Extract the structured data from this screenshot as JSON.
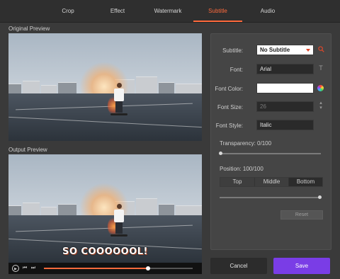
{
  "tabs": [
    {
      "label": "Crop"
    },
    {
      "label": "Effect"
    },
    {
      "label": "Watermark"
    },
    {
      "label": "Subtitle",
      "active": true
    },
    {
      "label": "Audio"
    }
  ],
  "original_preview": {
    "label": "Original Preview"
  },
  "output_preview": {
    "label": "Output Preview",
    "subtitle_text": "SO COOOOOOL!"
  },
  "player": {
    "play_icon": "play-icon",
    "prev_icon": "previous-icon",
    "next_icon": "next-icon",
    "progress": 0.7
  },
  "settings": {
    "subtitle": {
      "label": "Subtitle:",
      "value": "No Subtitle",
      "icon": "search-icon"
    },
    "font": {
      "label": "Font:",
      "value": "Arial",
      "icon": "text-icon"
    },
    "font_color": {
      "label": "Font Color:",
      "value": "#ffffff",
      "icon": "color-wheel-icon"
    },
    "font_size": {
      "label": "Font Size:",
      "value": "26",
      "icon": "stepper-icon"
    },
    "font_style": {
      "label": "Font Style:",
      "value": "Italic"
    },
    "transparency": {
      "label": "Transparency: 0/100",
      "value": 0
    },
    "position": {
      "label": "Position: 100/100",
      "value": 1,
      "options": [
        "Top",
        "Middle",
        "Bottom"
      ],
      "selected": "Bottom"
    },
    "reset_label": "Reset"
  },
  "buttons": {
    "cancel": "Cancel",
    "save": "Save"
  },
  "colors": {
    "accent": "#ff6a3c",
    "save": "#7a3de6",
    "background": "#3a3a3a"
  }
}
